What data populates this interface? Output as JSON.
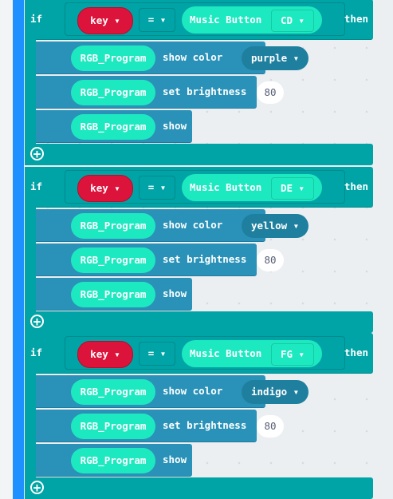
{
  "colors": {
    "if_block": "#00a4a6",
    "statement": "#2a92b8",
    "pill": "#1de9c1",
    "key_variable": "#dc143c",
    "accent_bar": "#1e90ff"
  },
  "blocks": [
    {
      "if": "if",
      "variable": "key ▾",
      "operator": "= ▾",
      "music_label": "Music Button",
      "music_value": "CD ▾",
      "then": "then",
      "statements": [
        {
          "pill": "RGB_Program",
          "text": "show color",
          "dropdown": "purple ▾"
        },
        {
          "pill": "RGB_Program",
          "text": "set brightness",
          "number": "80"
        },
        {
          "pill": "RGB_Program",
          "text": "show"
        }
      ]
    },
    {
      "if": "if",
      "variable": "key ▾",
      "operator": "= ▾",
      "music_label": "Music Button",
      "music_value": "DE ▾",
      "then": "then",
      "statements": [
        {
          "pill": "RGB_Program",
          "text": "show color",
          "dropdown": "yellow ▾"
        },
        {
          "pill": "RGB_Program",
          "text": "set brightness",
          "number": "80"
        },
        {
          "pill": "RGB_Program",
          "text": "show"
        }
      ]
    },
    {
      "if": "if",
      "variable": "key ▾",
      "operator": "= ▾",
      "music_label": "Music Button",
      "music_value": "FG ▾",
      "then": "then",
      "statements": [
        {
          "pill": "RGB_Program",
          "text": "show color",
          "dropdown": "indigo ▾"
        },
        {
          "pill": "RGB_Program",
          "text": "set brightness",
          "number": "80"
        },
        {
          "pill": "RGB_Program",
          "text": "show"
        }
      ]
    }
  ]
}
